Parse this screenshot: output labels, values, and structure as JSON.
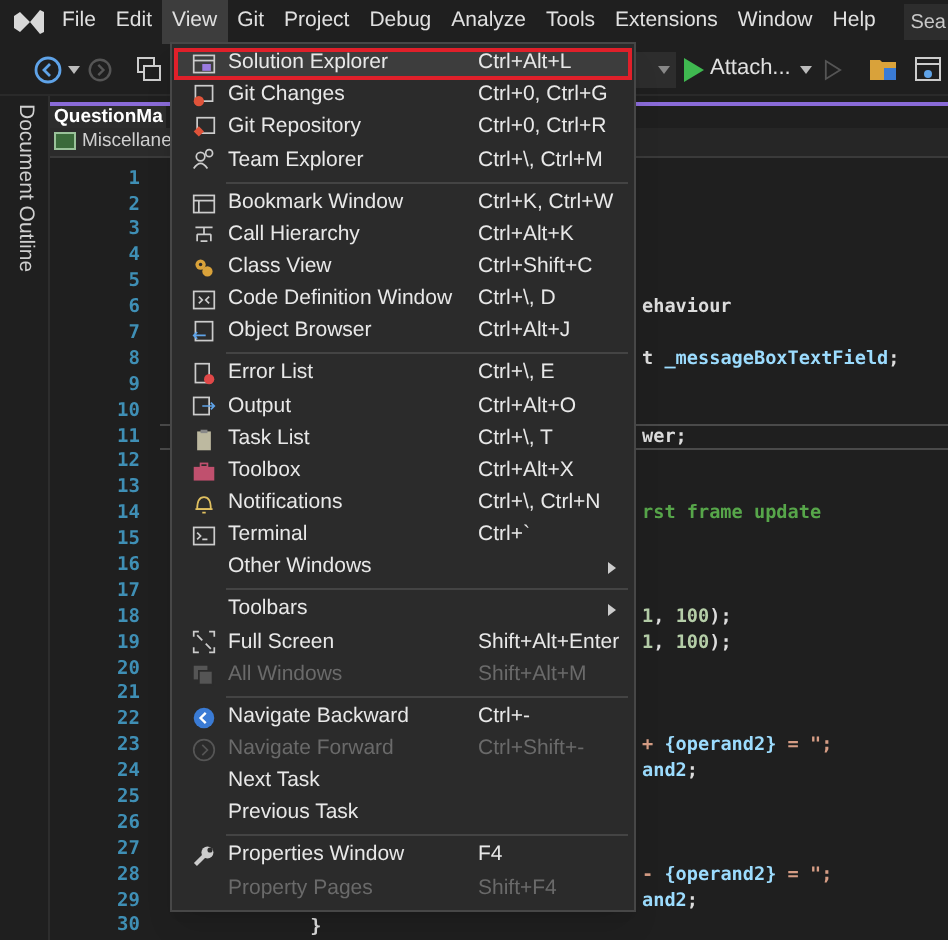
{
  "menu_bar": {
    "items": [
      {
        "label": "File",
        "selected": false
      },
      {
        "label": "Edit",
        "selected": false
      },
      {
        "label": "View",
        "selected": true
      },
      {
        "label": "Git",
        "selected": false
      },
      {
        "label": "Project",
        "selected": false
      },
      {
        "label": "Debug",
        "selected": false
      },
      {
        "label": "Analyze",
        "selected": false
      },
      {
        "label": "Tools",
        "selected": false
      },
      {
        "label": "Extensions",
        "selected": false
      },
      {
        "label": "Window",
        "selected": false
      },
      {
        "label": "Help",
        "selected": false
      }
    ],
    "search": {
      "placeholder": "Sea"
    }
  },
  "toolbar": {
    "attach_button": "Attach..."
  },
  "side_tab": "Document Outline",
  "editor": {
    "tab": "QuestionMa",
    "nav_bar": "Miscellane",
    "lines": [
      {
        "number": "1",
        "current": false
      },
      {
        "number": "2",
        "current": false
      },
      {
        "number": "3",
        "current": false
      },
      {
        "number": "4",
        "current": false
      },
      {
        "number": "5",
        "current": false
      },
      {
        "number": "6",
        "current": false,
        "kind": "clipped",
        "segments": [
          {
            "kind": "plain",
            "text": "ehaviour"
          }
        ]
      },
      {
        "number": "7",
        "current": false
      },
      {
        "number": "8",
        "current": false,
        "kind": "clipped",
        "segments": [
          {
            "kind": "plain",
            "text": "t "
          },
          {
            "kind": "field",
            "text": "_messageBoxTextField"
          },
          {
            "kind": "plain",
            "text": ";"
          }
        ]
      },
      {
        "number": "9",
        "current": false
      },
      {
        "number": "10",
        "current": false
      },
      {
        "number": "11",
        "current": true,
        "kind": "clipped",
        "segments": [
          {
            "kind": "plain",
            "text": "wer;"
          }
        ]
      },
      {
        "number": "12",
        "current": false
      },
      {
        "number": "13",
        "current": false
      },
      {
        "number": "14",
        "current": false,
        "kind": "clipped",
        "segments": [
          {
            "kind": "comment",
            "text": "rst frame update"
          }
        ]
      },
      {
        "number": "15",
        "current": false
      },
      {
        "number": "16",
        "current": false
      },
      {
        "number": "17",
        "current": false
      },
      {
        "number": "18",
        "current": false,
        "kind": "clipped",
        "segments": [
          {
            "kind": "number",
            "text": "1"
          },
          {
            "kind": "plain",
            "text": ", "
          },
          {
            "kind": "number",
            "text": "100"
          },
          {
            "kind": "plain",
            "text": ");"
          }
        ]
      },
      {
        "number": "19",
        "current": false,
        "kind": "clipped",
        "segments": [
          {
            "kind": "number",
            "text": "1"
          },
          {
            "kind": "plain",
            "text": ", "
          },
          {
            "kind": "number",
            "text": "100"
          },
          {
            "kind": "plain",
            "text": ");"
          }
        ]
      },
      {
        "number": "20",
        "current": false
      },
      {
        "number": "21",
        "current": false
      },
      {
        "number": "22",
        "current": false
      },
      {
        "number": "23",
        "current": false,
        "kind": "clipped",
        "segments": [
          {
            "kind": "string",
            "text": "+ "
          },
          {
            "kind": "variable",
            "text": "{operand2}"
          },
          {
            "kind": "string",
            "text": " = \";"
          }
        ]
      },
      {
        "number": "24",
        "current": false,
        "kind": "clipped",
        "segments": [
          {
            "kind": "variable",
            "text": "and2"
          },
          {
            "kind": "plain",
            "text": ";"
          }
        ]
      },
      {
        "number": "25",
        "current": false
      },
      {
        "number": "26",
        "current": false
      },
      {
        "number": "27",
        "current": false
      },
      {
        "number": "28",
        "current": false,
        "kind": "clipped",
        "segments": [
          {
            "kind": "string",
            "text": "- "
          },
          {
            "kind": "variable",
            "text": "{operand2}"
          },
          {
            "kind": "string",
            "text": " = \";"
          }
        ]
      },
      {
        "number": "29",
        "current": false,
        "kind": "clipped",
        "segments": [
          {
            "kind": "variable",
            "text": "and2"
          },
          {
            "kind": "plain",
            "text": ";"
          }
        ]
      },
      {
        "number": "30",
        "current": false,
        "kind": "full",
        "segments": [
          {
            "kind": "plain",
            "text": "            }"
          }
        ]
      }
    ]
  },
  "view_menu": {
    "groups": [
      [
        {
          "label": "Solution Explorer",
          "shortcut": "Ctrl+Alt+L",
          "selected": true,
          "disabled": false,
          "submenu": false
        },
        {
          "label": "Git Changes",
          "shortcut": "Ctrl+0, Ctrl+G",
          "selected": false,
          "disabled": false,
          "submenu": false
        },
        {
          "label": "Git Repository",
          "shortcut": "Ctrl+0, Ctrl+R",
          "selected": false,
          "disabled": false,
          "submenu": false
        },
        {
          "label": "Team Explorer",
          "shortcut": "Ctrl+\\, Ctrl+M",
          "selected": false,
          "disabled": false,
          "submenu": false
        }
      ],
      [
        {
          "label": "Bookmark Window",
          "shortcut": "Ctrl+K, Ctrl+W",
          "selected": false,
          "disabled": false,
          "submenu": false
        },
        {
          "label": "Call Hierarchy",
          "shortcut": "Ctrl+Alt+K",
          "selected": false,
          "disabled": false,
          "submenu": false
        },
        {
          "label": "Class View",
          "shortcut": "Ctrl+Shift+C",
          "selected": false,
          "disabled": false,
          "submenu": false
        },
        {
          "label": "Code Definition Window",
          "shortcut": "Ctrl+\\, D",
          "selected": false,
          "disabled": false,
          "submenu": false
        },
        {
          "label": "Object Browser",
          "shortcut": "Ctrl+Alt+J",
          "selected": false,
          "disabled": false,
          "submenu": false
        }
      ],
      [
        {
          "label": "Error List",
          "shortcut": "Ctrl+\\, E",
          "selected": false,
          "disabled": false,
          "submenu": false
        },
        {
          "label": "Output",
          "shortcut": "Ctrl+Alt+O",
          "selected": false,
          "disabled": false,
          "submenu": false
        },
        {
          "label": "Task List",
          "shortcut": "Ctrl+\\, T",
          "selected": false,
          "disabled": false,
          "submenu": false
        },
        {
          "label": "Toolbox",
          "shortcut": "Ctrl+Alt+X",
          "selected": false,
          "disabled": false,
          "submenu": false
        },
        {
          "label": "Notifications",
          "shortcut": "Ctrl+\\, Ctrl+N",
          "selected": false,
          "disabled": false,
          "submenu": false
        },
        {
          "label": "Terminal",
          "shortcut": "Ctrl+`",
          "selected": false,
          "disabled": false,
          "submenu": false
        },
        {
          "label": "Other Windows",
          "selected": false,
          "disabled": false,
          "submenu": true
        }
      ],
      [
        {
          "label": "Toolbars",
          "selected": false,
          "disabled": false,
          "submenu": true
        },
        {
          "label": "Full Screen",
          "shortcut": "Shift+Alt+Enter",
          "selected": false,
          "disabled": false,
          "submenu": false
        },
        {
          "label": "All Windows",
          "shortcut": "Shift+Alt+M",
          "selected": false,
          "disabled": true,
          "submenu": false
        }
      ],
      [
        {
          "label": "Navigate Backward",
          "shortcut": "Ctrl+-",
          "selected": false,
          "disabled": false,
          "submenu": false
        },
        {
          "label": "Navigate Forward",
          "shortcut": "Ctrl+Shift+-",
          "selected": false,
          "disabled": true,
          "submenu": false
        },
        {
          "label": "Next Task",
          "selected": false,
          "disabled": false,
          "submenu": false
        },
        {
          "label": "Previous Task",
          "selected": false,
          "disabled": false,
          "submenu": false
        }
      ],
      [
        {
          "label": "Properties Window",
          "shortcut": "F4",
          "selected": false,
          "disabled": false,
          "submenu": false
        },
        {
          "label": "Property Pages",
          "shortcut": "Shift+F4",
          "selected": false,
          "disabled": true,
          "submenu": false
        }
      ]
    ]
  }
}
